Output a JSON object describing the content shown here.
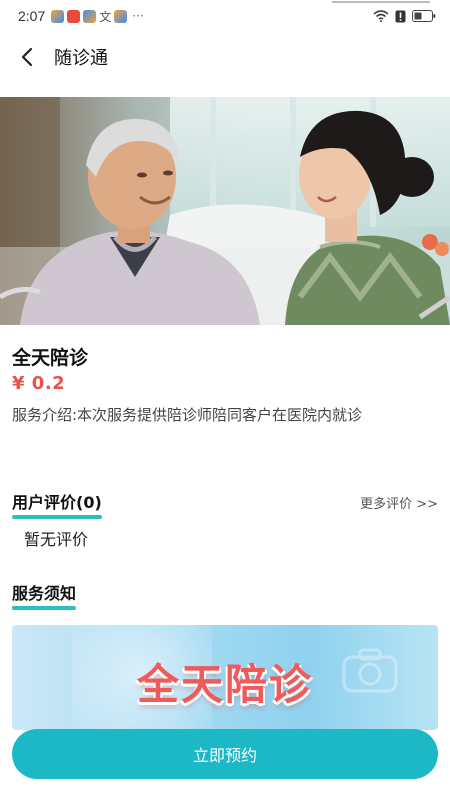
{
  "status_bar": {
    "time": "2:07",
    "notif_text": "文",
    "dots": "···"
  },
  "nav": {
    "title": "随诊通"
  },
  "service": {
    "title": "全天陪诊",
    "price": "¥ 0.2",
    "description": "服务介绍:本次服务提供陪诊师陪同客户在医院内就诊"
  },
  "reviews": {
    "header": "用户评价(0)",
    "more_link": "更多评价 >>",
    "empty_text": "暂无评价"
  },
  "notice": {
    "header": "服务须知"
  },
  "banner": {
    "text": "全天陪诊"
  },
  "actions": {
    "book_label": "立即预约"
  },
  "colors": {
    "accent": "#1cb8c5",
    "underline": "#2bbfc4",
    "price": "#e8524a"
  }
}
